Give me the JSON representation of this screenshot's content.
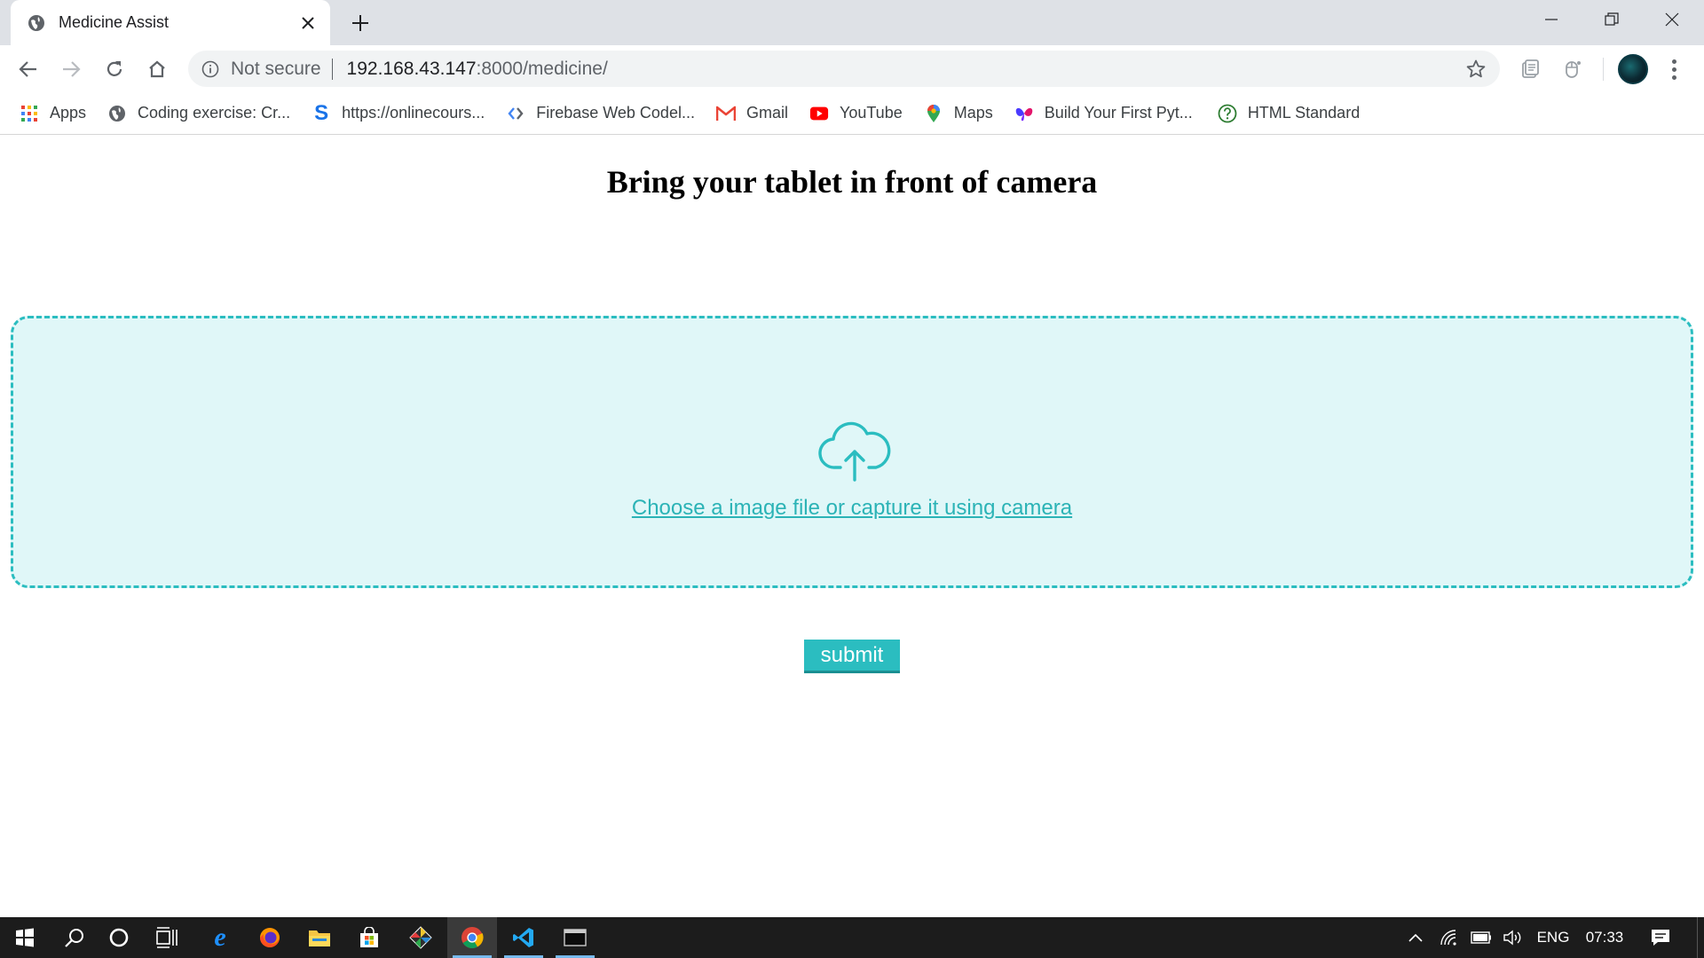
{
  "browser": {
    "tab_title": "Medicine Assist",
    "security_label": "Not secure",
    "url_host": "192.168.43.147",
    "url_rest": ":8000/medicine/"
  },
  "bookmarks": [
    {
      "label": "Apps",
      "icon": "apps-grid-icon"
    },
    {
      "label": "Coding exercise: Cr...",
      "icon": "globe-icon"
    },
    {
      "label": "https://onlinecours...",
      "icon": "s-logo-icon"
    },
    {
      "label": "Firebase Web Codel...",
      "icon": "codelabs-icon"
    },
    {
      "label": "Gmail",
      "icon": "gmail-icon"
    },
    {
      "label": "YouTube",
      "icon": "youtube-icon"
    },
    {
      "label": "Maps",
      "icon": "maps-pin-icon"
    },
    {
      "label": "Build Your First Pyt...",
      "icon": "butterfly-icon"
    },
    {
      "label": "HTML Standard",
      "icon": "question-circle-icon"
    }
  ],
  "page": {
    "heading": "Bring your tablet in front of camera",
    "upload_link": "Choose a image file or capture it using camera",
    "submit_label": "submit"
  },
  "taskbar": {
    "language": "ENG",
    "time": "07:33"
  },
  "colors": {
    "accent": "#2bbdc0",
    "dropzone_bg": "#e0f7f8",
    "link": "#2bb3b6"
  }
}
